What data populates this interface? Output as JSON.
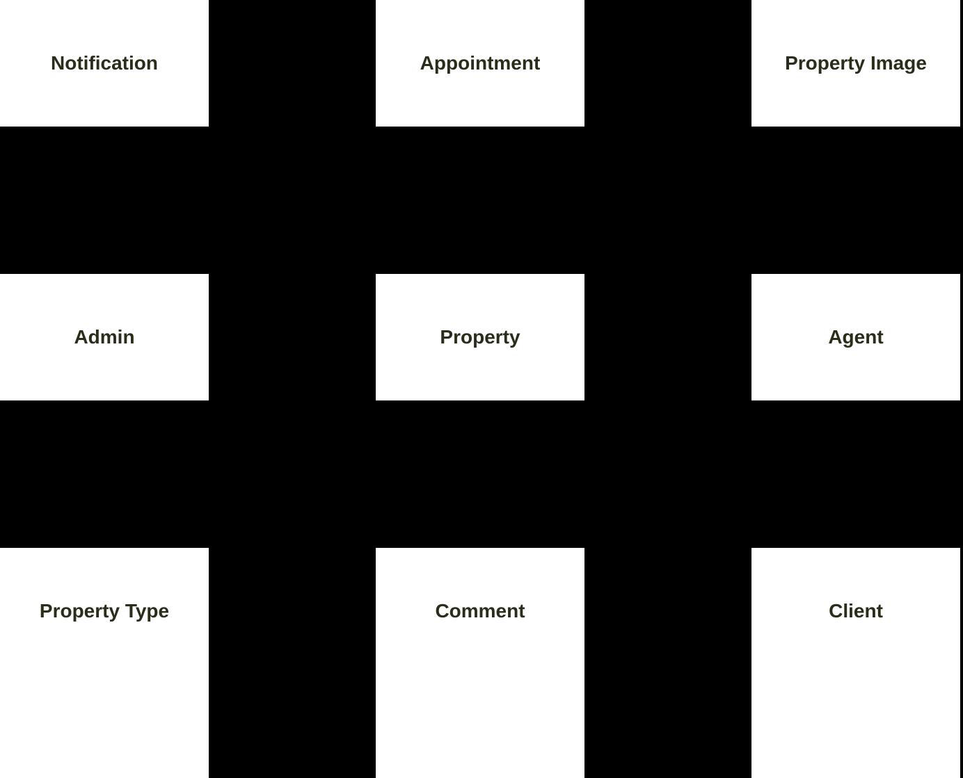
{
  "tiles": {
    "notification": "Notification",
    "appointment": "Appointment",
    "property_image": "Property Image",
    "admin": "Admin",
    "property": "Property",
    "agent": "Agent",
    "property_type": "Property Type",
    "comment": "Comment",
    "client": "Client"
  },
  "colors": {
    "background": "#000000",
    "tile_bg": "#ffffff",
    "label_color": "#2c2c1a"
  }
}
